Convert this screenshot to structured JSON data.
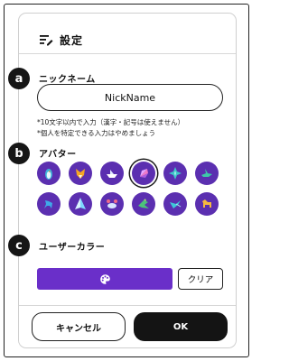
{
  "dialog": {
    "title": "設定",
    "title_icon": "settings-edit-icon"
  },
  "sections": {
    "a": {
      "badge": "a",
      "label": "ニックネーム"
    },
    "b": {
      "badge": "b",
      "label": "アバター"
    },
    "c": {
      "badge": "c",
      "label": "ユーザーカラー"
    }
  },
  "nickname": {
    "value": "NickName",
    "notes": [
      "*10文字以内で入力（漢字・記号は使えません）",
      "*個人を特定できる入力はやめましょう"
    ]
  },
  "avatars": [
    {
      "icon": "penguin-icon",
      "selected": false
    },
    {
      "icon": "fox-icon",
      "selected": false
    },
    {
      "icon": "boat-icon",
      "selected": false
    },
    {
      "icon": "crystal-icon",
      "selected": true
    },
    {
      "icon": "star-icon",
      "selected": false
    },
    {
      "icon": "crane-icon",
      "selected": false
    },
    {
      "icon": "horse-icon",
      "selected": false
    },
    {
      "icon": "pyramid-icon",
      "selected": false
    },
    {
      "icon": "crab-icon",
      "selected": false
    },
    {
      "icon": "bird-icon",
      "selected": false
    },
    {
      "icon": "hummingbird-icon",
      "selected": false
    },
    {
      "icon": "dog-icon",
      "selected": false
    }
  ],
  "user_color": {
    "value": "#6a2fc9",
    "picker_icon": "palette-icon",
    "clear_label": "クリア"
  },
  "footer": {
    "cancel_label": "キャンセル",
    "ok_label": "OK"
  },
  "colors": {
    "avatar_bg": "#5b2fb0",
    "accent": "#6a2fc9",
    "dark": "#141414"
  }
}
